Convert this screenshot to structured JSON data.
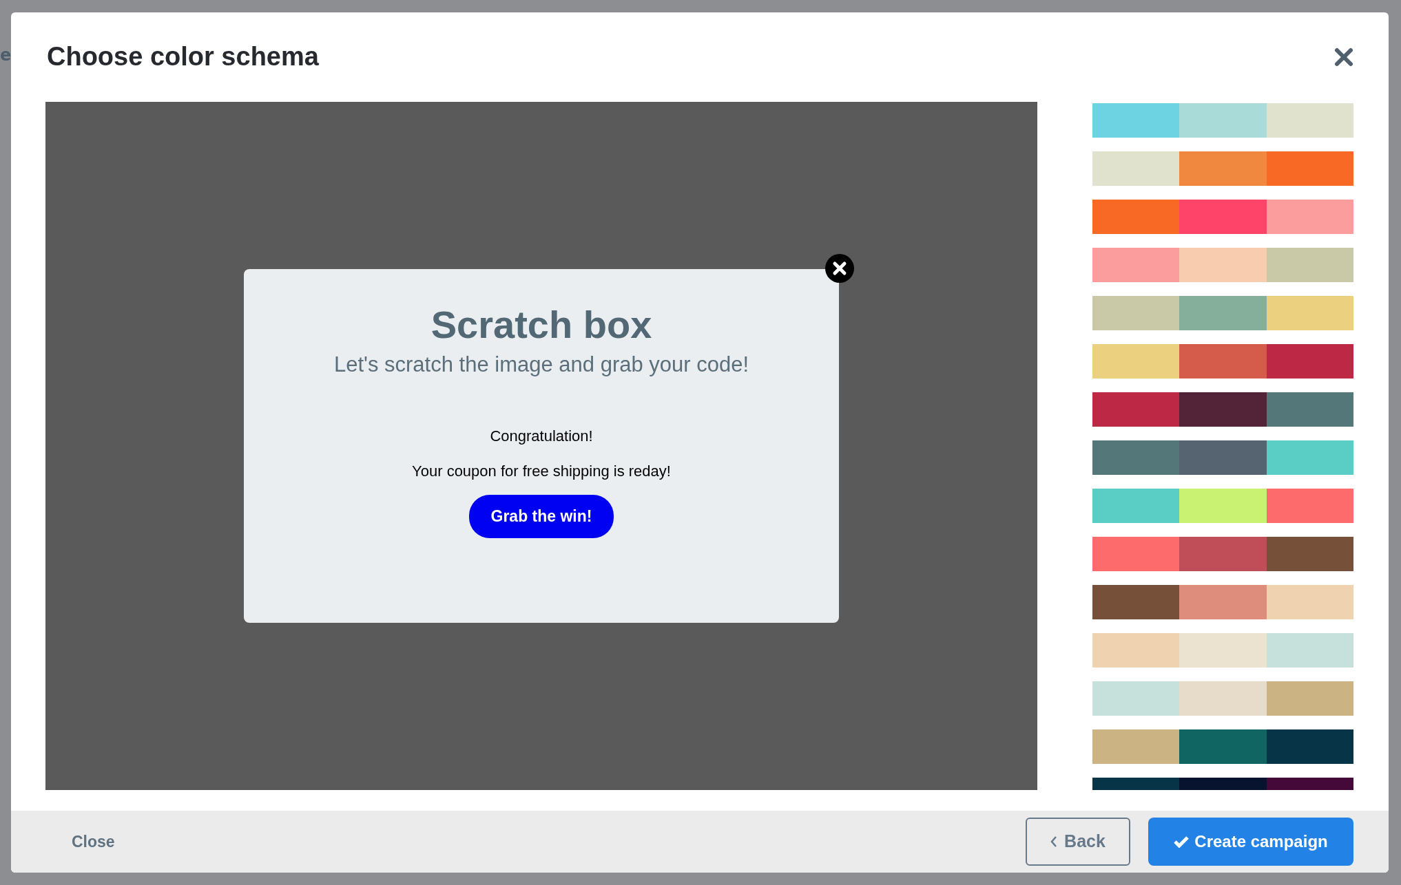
{
  "background": {
    "fragment": "e"
  },
  "modal": {
    "title": "Choose color schema"
  },
  "preview": {
    "title": "Scratch box",
    "subtitle": "Let's scratch the image and grab your code!",
    "message": "Congratulation!",
    "coupon": "Your coupon for free shipping is reday!",
    "button": "Grab the win!"
  },
  "palettes": [
    {
      "swatches": [
        {
          "color": "#6dd3e3"
        },
        {
          "color": "#a9dbd8"
        },
        {
          "color": "#e0e2cd"
        }
      ]
    },
    {
      "swatches": [
        {
          "color": "#e0e2cd"
        },
        {
          "color": "#f1883f"
        },
        {
          "color": "#f86925"
        }
      ]
    },
    {
      "swatches": [
        {
          "color": "#f86925"
        },
        {
          "color": "#fe4469"
        },
        {
          "color": "#fa9d9c"
        }
      ]
    },
    {
      "swatches": [
        {
          "color": "#fa9d9c"
        },
        {
          "color": "#f8ccae"
        },
        {
          "color": "#c9c9a8"
        }
      ]
    },
    {
      "swatches": [
        {
          "color": "#c9c9a8"
        },
        {
          "color": "#86af9b"
        },
        {
          "color": "#ead07f"
        }
      ]
    },
    {
      "swatches": [
        {
          "color": "#ead07f"
        },
        {
          "color": "#d55c4a"
        },
        {
          "color": "#bd2944"
        }
      ]
    },
    {
      "swatches": [
        {
          "color": "#bd2944"
        },
        {
          "color": "#532437"
        },
        {
          "color": "#547879"
        }
      ]
    },
    {
      "swatches": [
        {
          "color": "#547879"
        },
        {
          "color": "#566472"
        },
        {
          "color": "#5acdc5"
        }
      ]
    },
    {
      "swatches": [
        {
          "color": "#5acdc5"
        },
        {
          "color": "#c9f272"
        },
        {
          "color": "#fd6b6d"
        }
      ]
    },
    {
      "swatches": [
        {
          "color": "#fd6b6d"
        },
        {
          "color": "#c04e59"
        },
        {
          "color": "#775039"
        }
      ]
    },
    {
      "swatches": [
        {
          "color": "#775039"
        },
        {
          "color": "#de8c7b"
        },
        {
          "color": "#efd2b0"
        }
      ]
    },
    {
      "swatches": [
        {
          "color": "#efd2b0"
        },
        {
          "color": "#ebe3d0"
        },
        {
          "color": "#c6e0db"
        }
      ]
    },
    {
      "swatches": [
        {
          "color": "#c6e0db"
        },
        {
          "color": "#e7dbca"
        },
        {
          "color": "#cbb384"
        }
      ]
    },
    {
      "swatches": [
        {
          "color": "#cbb384"
        },
        {
          "color": "#106462"
        },
        {
          "color": "#073447"
        }
      ]
    },
    {
      "swatches": [
        {
          "color": "#073447"
        },
        {
          "color": "#07132f"
        },
        {
          "color": "#450939"
        }
      ]
    }
  ],
  "footer": {
    "close": "Close",
    "back": "Back",
    "create": "Create campaign"
  }
}
